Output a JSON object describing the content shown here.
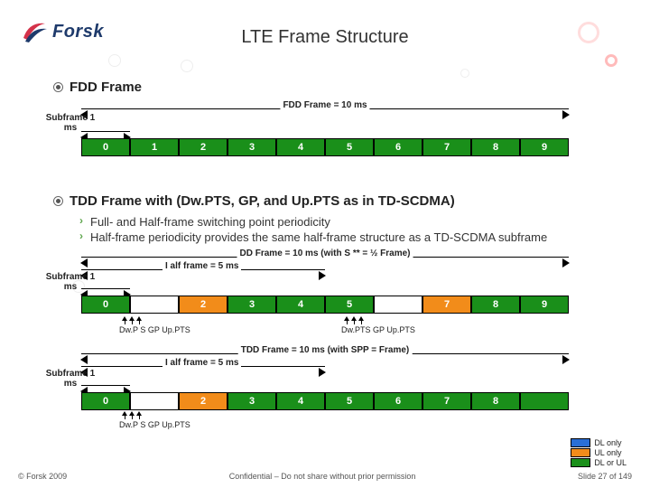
{
  "logo_text": "Forsk",
  "title": "LTE Frame Structure",
  "section1": {
    "heading": "FDD Frame",
    "frame_label": "FDD Frame = 10 ms",
    "subframe_label": "Subframe 1 ms",
    "cells": [
      "0",
      "1",
      "2",
      "3",
      "4",
      "5",
      "6",
      "7",
      "8",
      "9"
    ]
  },
  "section2": {
    "heading": "TDD Frame with (Dw.PTS, GP, and Up.PTS as in TD-SCDMA)",
    "bullets": [
      "Full- and Half-frame switching point periodicity",
      "Half-frame periodicity provides the same half-frame structure as a TD-SCDMA subframe"
    ],
    "diag_a": {
      "top": "DD Frame = 10 ms (with S ** = ½ Frame)",
      "half": "I alf frame = 5 ms",
      "subframe": "Subframe 1 ms",
      "cells": [
        "0",
        "",
        "2",
        "3",
        "4",
        "5",
        "",
        "7",
        "8",
        "9"
      ],
      "pts": "Dw.P S GP Up.PTS",
      "pts2": "Dw.PTS GP Up.PTS"
    },
    "diag_b": {
      "top": "TDD Frame = 10 ms (with SPP = Frame)",
      "half": "I alf frame = 5 ms",
      "subframe": "Subframe 1 ms",
      "cells": [
        "0",
        "",
        "2",
        "3",
        "4",
        "5",
        "6",
        "7",
        "8",
        ""
      ],
      "pts": "Dw.P S GP Up.PTS"
    }
  },
  "legend": {
    "dl": "DL only",
    "ul": "UL only",
    "both": "DL or UL"
  },
  "footer": {
    "left": "© Forsk 2009",
    "center": "Confidential – Do not share without prior permission",
    "right": "Slide 27 of 149"
  }
}
